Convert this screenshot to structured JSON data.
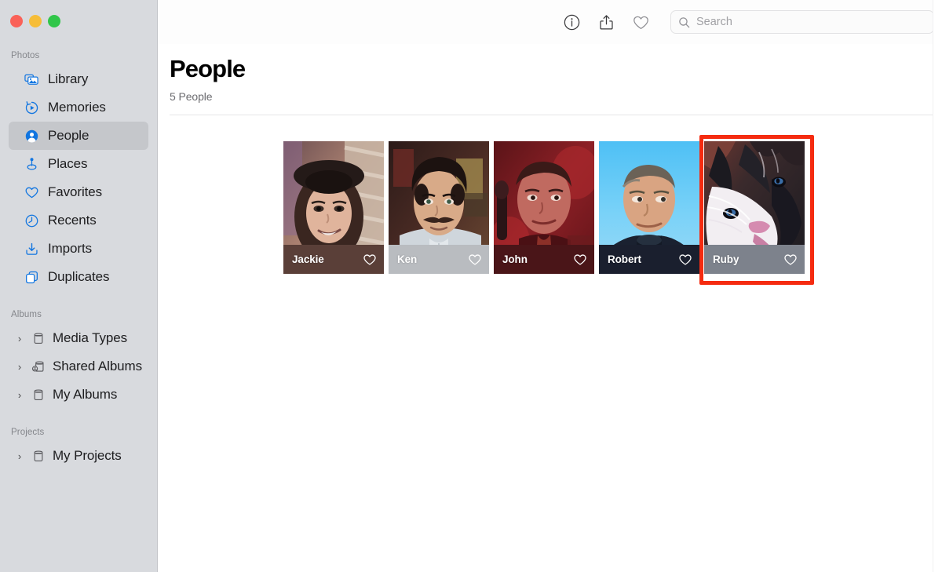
{
  "window": {
    "controls": [
      {
        "name": "close",
        "color": "#fa6158"
      },
      {
        "name": "minimize",
        "color": "#f6bd38"
      },
      {
        "name": "zoom",
        "color": "#31c64a"
      }
    ]
  },
  "sidebar": {
    "sections": [
      {
        "title": "Photos",
        "items": [
          {
            "label": "Library",
            "icon": "library-icon",
            "selected": false
          },
          {
            "label": "Memories",
            "icon": "memories-icon",
            "selected": false
          },
          {
            "label": "People",
            "icon": "people-icon",
            "selected": true
          },
          {
            "label": "Places",
            "icon": "places-icon",
            "selected": false
          },
          {
            "label": "Favorites",
            "icon": "heart-icon",
            "selected": false
          },
          {
            "label": "Recents",
            "icon": "clock-icon",
            "selected": false
          },
          {
            "label": "Imports",
            "icon": "import-icon",
            "selected": false
          },
          {
            "label": "Duplicates",
            "icon": "duplicates-icon",
            "selected": false
          }
        ]
      },
      {
        "title": "Albums",
        "items": [
          {
            "label": "Media Types",
            "icon": "album-icon",
            "chevron": "›"
          },
          {
            "label": "Shared Albums",
            "icon": "shared-album-icon",
            "chevron": "›"
          },
          {
            "label": "My Albums",
            "icon": "album-icon",
            "chevron": "›"
          }
        ]
      },
      {
        "title": "Projects",
        "items": [
          {
            "label": "My Projects",
            "icon": "album-icon",
            "chevron": "›"
          }
        ]
      }
    ]
  },
  "toolbar": {
    "info_label": "Info",
    "share_label": "Share",
    "favorite_label": "Favorite",
    "search": {
      "value": "",
      "placeholder": "Search"
    }
  },
  "header": {
    "title": "People",
    "subtitle": "5 People"
  },
  "grid": {
    "people": [
      {
        "name": "Jackie",
        "namebar_color": "#5a3f38",
        "favorite": false
      },
      {
        "name": "Ken",
        "namebar_color": "#b9bcc0",
        "favorite": false
      },
      {
        "name": "John",
        "namebar_color": "#4a1518",
        "favorite": false
      },
      {
        "name": "Robert",
        "namebar_color": "#1a1f2e",
        "favorite": false
      },
      {
        "name": "Ruby",
        "namebar_color": "#7d828c",
        "favorite": false
      }
    ]
  },
  "selection": {
    "person": "Ruby",
    "highlight_color": "#f52b10"
  }
}
